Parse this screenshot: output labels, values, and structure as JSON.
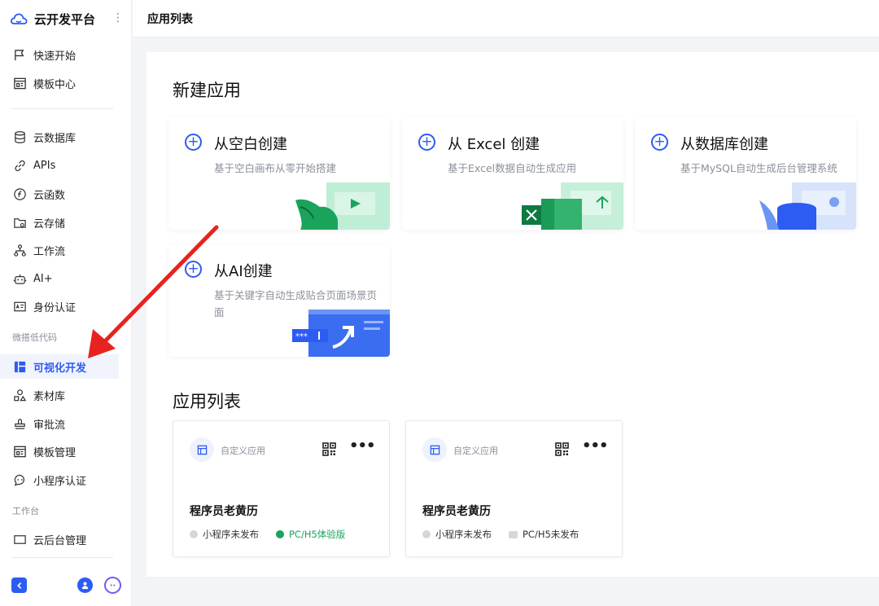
{
  "brand": {
    "title": "云开发平台",
    "more_icon": "vertical-dots"
  },
  "sidebar": {
    "top_items": [
      {
        "label": "快速开始",
        "icon": "flag-icon"
      },
      {
        "label": "模板中心",
        "icon": "template-icon"
      }
    ],
    "items": [
      {
        "label": "云数据库",
        "icon": "database-icon"
      },
      {
        "label": "APIs",
        "icon": "link-icon"
      },
      {
        "label": "云函数",
        "icon": "function-icon"
      },
      {
        "label": "云存储",
        "icon": "folder-icon"
      },
      {
        "label": "工作流",
        "icon": "workflow-icon"
      },
      {
        "label": "AI+",
        "icon": "robot-icon"
      },
      {
        "label": "身份认证",
        "icon": "id-card-icon"
      }
    ],
    "section_lowcode": "微搭低代码",
    "lowcode_items": [
      {
        "label": "可视化开发",
        "icon": "layout-icon",
        "active": true
      },
      {
        "label": "素材库",
        "icon": "shapes-icon"
      },
      {
        "label": "审批流",
        "icon": "stamp-icon"
      },
      {
        "label": "模板管理",
        "icon": "template-icon"
      },
      {
        "label": "小程序认证",
        "icon": "chat-icon"
      }
    ],
    "section_workbench": "工作台",
    "workbench_items": [
      {
        "label": "云后台管理",
        "icon": "monitor-icon"
      }
    ]
  },
  "header": {
    "title": "应用列表"
  },
  "new_app": {
    "heading": "新建应用",
    "cards": [
      {
        "title": "从空白创建",
        "desc": "基于空白画布从零开始搭建"
      },
      {
        "title": "从 Excel 创建",
        "desc": "基于Excel数据自动生成应用"
      },
      {
        "title": "从数据库创建",
        "desc": "基于MySQL自动生成后台管理系统"
      },
      {
        "title": "从AI创建",
        "desc": "基于关键字自动生成贴合页面场景页面"
      }
    ]
  },
  "app_list": {
    "heading": "应用列表",
    "apps": [
      {
        "type": "自定义应用",
        "name": "程序员老黄历",
        "status_mp": "小程序未发布",
        "status_web": "PC/H5体验版",
        "web_live": true
      },
      {
        "type": "自定义应用",
        "name": "程序员老黄历",
        "status_mp": "小程序未发布",
        "status_web": "PC/H5未发布",
        "web_live": false
      }
    ]
  },
  "colors": {
    "accent": "#2c5cf2",
    "annotation": "#e8231f",
    "success": "#1aa35a"
  }
}
